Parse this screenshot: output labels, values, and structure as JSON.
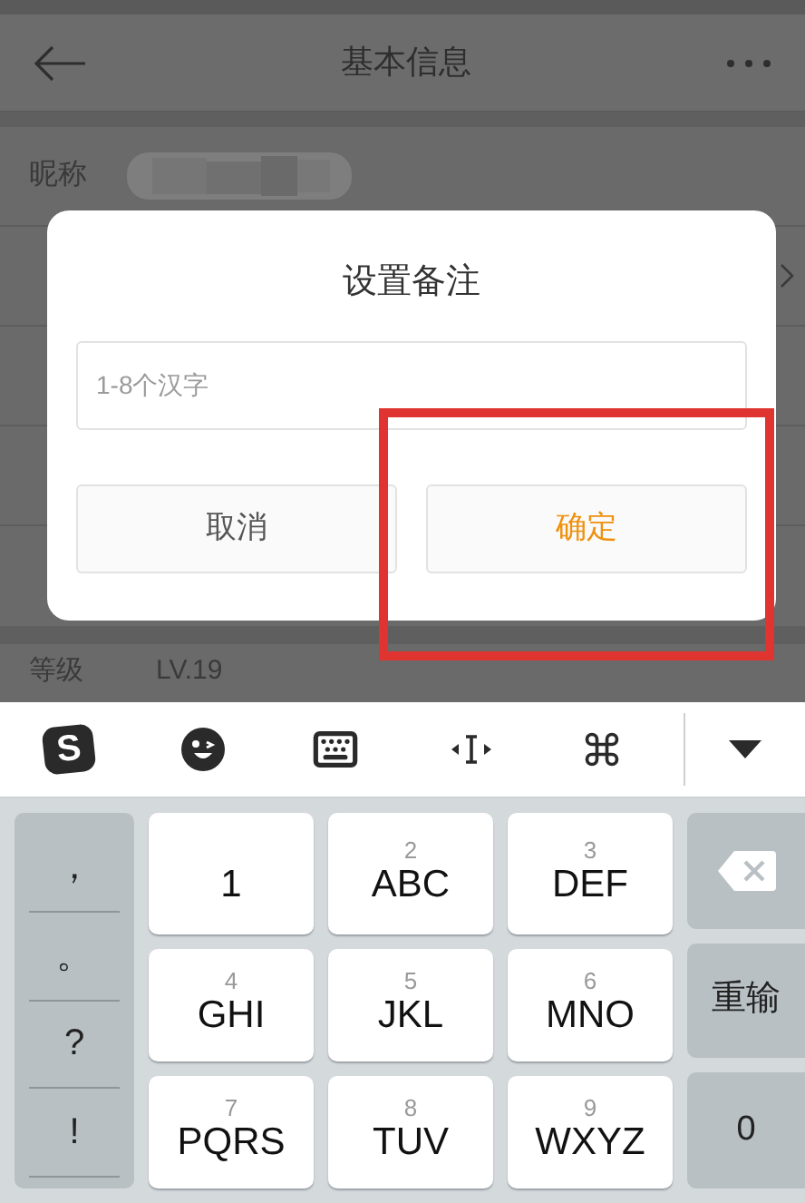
{
  "header": {
    "title": "基本信息"
  },
  "nickname_row": {
    "label": "昵称"
  },
  "level_row": {
    "label": "等级",
    "value": "LV.19"
  },
  "dialog": {
    "title": "设置备注",
    "input": {
      "placeholder": "1-8个汉字"
    },
    "buttons": [
      {
        "label": "取消",
        "kind": "cancel"
      },
      {
        "label": "确定",
        "kind": "confirm"
      }
    ]
  },
  "keyboard": {
    "logo": "S",
    "symbols": [
      "，",
      "。",
      "?",
      "!"
    ],
    "one_key": "1",
    "keys": [
      {
        "letters": "ABC",
        "digit": "2"
      },
      {
        "letters": "DEF",
        "digit": "3"
      },
      {
        "letters": "GHI",
        "digit": "4"
      },
      {
        "letters": "JKL",
        "digit": "5"
      },
      {
        "letters": "MNO",
        "digit": "6"
      },
      {
        "letters": "PQRS",
        "digit": "7"
      },
      {
        "letters": "TUV",
        "digit": "8"
      },
      {
        "letters": "WXYZ",
        "digit": "9"
      }
    ],
    "side_keys": [
      {
        "kind": "delete"
      },
      {
        "kind": "text",
        "label": "重输"
      },
      {
        "kind": "text",
        "label": "0"
      }
    ]
  }
}
